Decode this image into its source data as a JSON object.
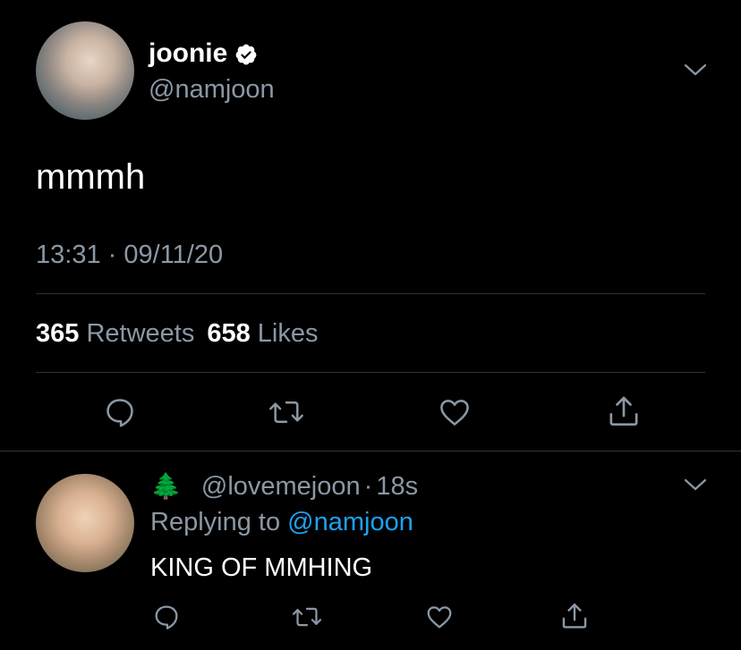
{
  "tweet": {
    "display_name": "joonie",
    "handle": "@namjoon",
    "text": "mmmh",
    "time": "13:31",
    "separator": "·",
    "date": "09/11/20",
    "retweet_count": "365",
    "retweet_label": "Retweets",
    "like_count": "658",
    "like_label": "Likes",
    "verified": true,
    "avatar_icon": "user-avatar"
  },
  "actions": [
    {
      "name": "reply",
      "icon": "reply-icon"
    },
    {
      "name": "retweet",
      "icon": "retweet-icon"
    },
    {
      "name": "like",
      "icon": "heart-icon"
    },
    {
      "name": "share",
      "icon": "share-icon"
    }
  ],
  "reply": {
    "emoji": "🌲",
    "handle": "@lovemejoon",
    "separator": "·",
    "time_ago": "18s",
    "replying_prefix": "Replying to",
    "replying_to": "@namjoon",
    "text": "KING OF MMHING"
  },
  "colors": {
    "background": "#000000",
    "text": "#ffffff",
    "muted": "#8b98a5",
    "accent": "#1da1f2",
    "divider": "#2f3336"
  }
}
